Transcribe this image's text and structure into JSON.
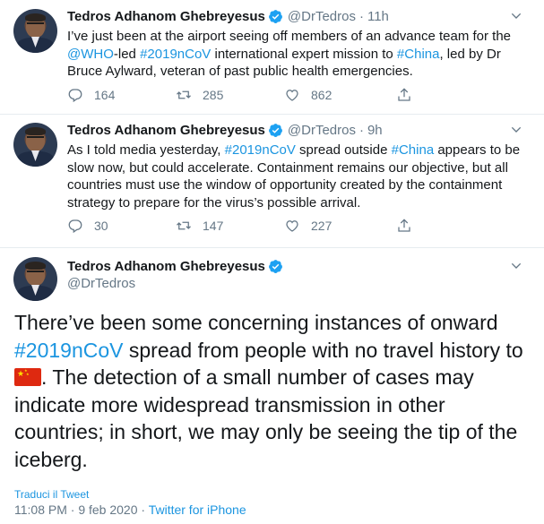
{
  "tweets": [
    {
      "name": "Tedros Adhanom Ghebreyesus",
      "handle": "@DrTedros",
      "separator": "·",
      "time": "11h",
      "text_parts": [
        "I’ve just been at the airport seeing off members of an advance team for the ",
        "@WHO",
        "-led ",
        "#2019nCoV",
        " international expert mission to ",
        "#China",
        ", led by Dr Bruce Aylward, veteran of past public health emergencies."
      ],
      "replies": "164",
      "retweets": "285",
      "likes": "862"
    },
    {
      "name": "Tedros Adhanom Ghebreyesus",
      "handle": "@DrTedros",
      "separator": "·",
      "time": "9h",
      "text_parts": [
        "As I told media yesterday, ",
        "#2019nCoV",
        " spread outside ",
        "#China",
        " appears to be slow now, but could accelerate. Containment remains our objective, but all countries must use the window of opportunity created by the containment strategy to prepare for the virus’s possible arrival."
      ],
      "replies": "30",
      "retweets": "147",
      "likes": "227"
    }
  ],
  "main_tweet": {
    "name": "Tedros Adhanom Ghebreyesus",
    "handle": "@DrTedros",
    "text_before_link": "There’ve been some concerning instances of onward ",
    "hashtag": "#2019nCoV",
    "text_mid": " spread from people with no travel history to ",
    "flag_icon": "china-flag-icon",
    "text_after": ". The detection of a small number of cases may indicate more widespread transmission in other countries; in short, we may only be seeing the tip of the iceberg.",
    "translate_label": "Traduci il Tweet",
    "timestamp": "11:08 PM · 9 feb 2020 · ",
    "source": "Twitter for iPhone"
  },
  "colors": {
    "link": "#1b95e0",
    "muted": "#657786",
    "text": "#14171a",
    "verified": "#1da1f2",
    "divider": "#e6ecf0"
  }
}
